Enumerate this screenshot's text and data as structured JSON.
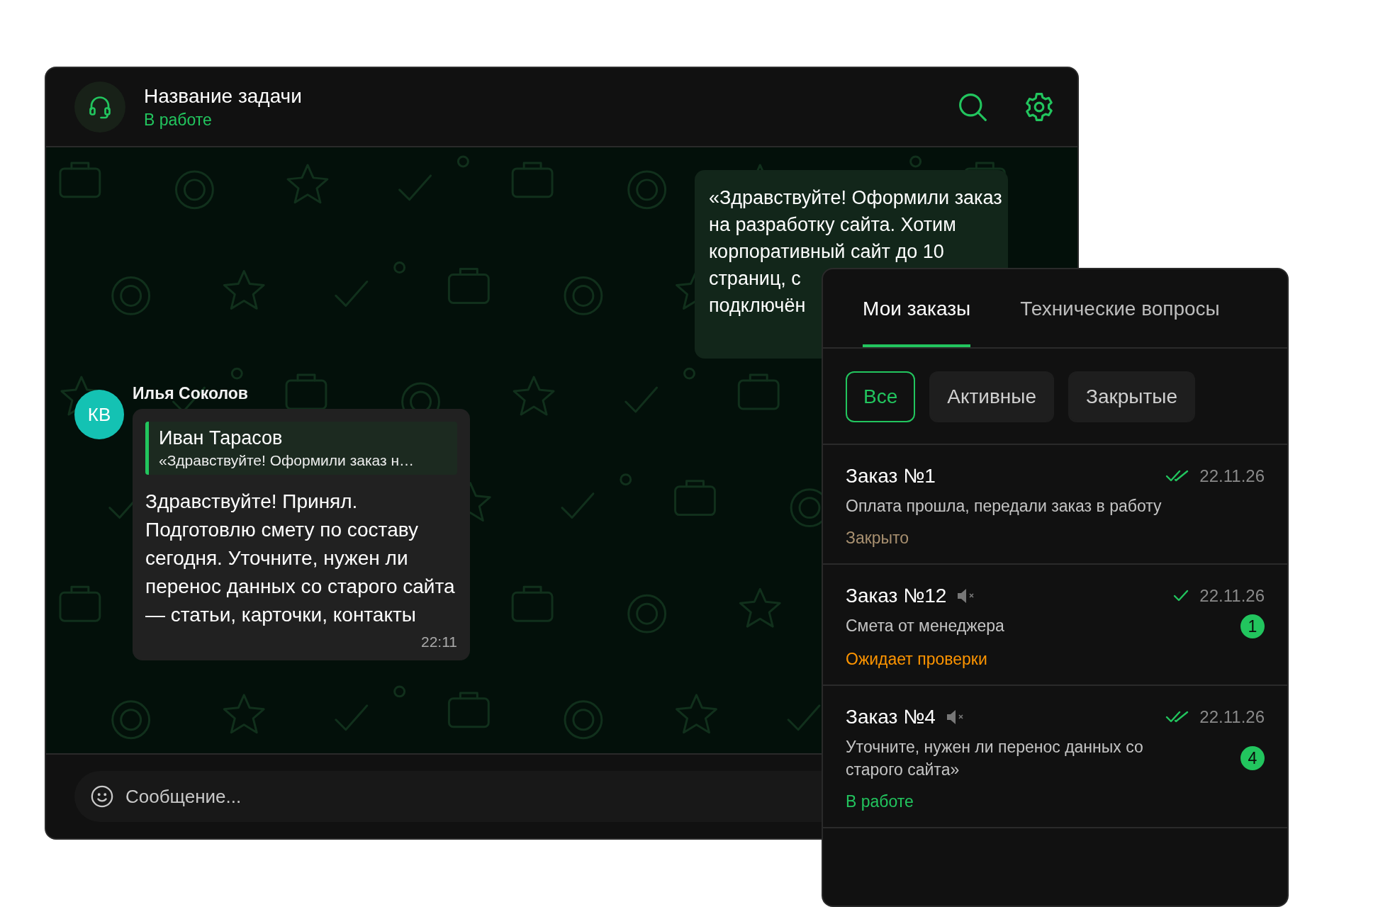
{
  "chat": {
    "title": "Название задачи",
    "status": "В работе",
    "outgoing_message": {
      "lines": [
        "«Здравствуйте! Оформили заказ",
        "на разработку сайта. Хотим",
        "корпоративный сайт до 10",
        "страниц, с",
        "подключён"
      ]
    },
    "incoming_message": {
      "avatar_initials": "КВ",
      "author": "Илья Соколов",
      "reply_to": {
        "author": "Иван Тарасов",
        "text": "«Здравствуйте! Оформили заказ н…"
      },
      "text": "Здравствуйте! Принял. Подготовлю смету по составу сегодня. Уточните, нужен ли перенос данных со старого сайта — статьи, карточки, контакты",
      "time": "22:11"
    },
    "composer": {
      "placeholder": "Сообщение..."
    }
  },
  "orders_panel": {
    "tabs": [
      {
        "label": "Мои заказы",
        "selected": true
      },
      {
        "label": "Технические вопросы",
        "selected": false
      }
    ],
    "filters": [
      {
        "label": "Все",
        "selected": true
      },
      {
        "label": "Активные",
        "selected": false
      },
      {
        "label": "Закрытые",
        "selected": false
      }
    ],
    "orders": [
      {
        "title": "Заказ №1",
        "muted": false,
        "read": true,
        "date": "22.11.26",
        "preview": "Оплата прошла, передали заказ в работу",
        "status": "Закрыто",
        "color": "#a89070"
      },
      {
        "title": "Заказ №12",
        "muted": true,
        "read": false,
        "date": "22.11.26",
        "preview": "Смета от менеджера",
        "unread": "1",
        "status": "Ожидает проверки",
        "color": "#ff9500"
      },
      {
        "title": "Заказ №4",
        "muted": true,
        "read": true,
        "date": "22.11.26",
        "preview": "Уточните, нужен ли перенос данных со старого сайта»",
        "unread": "4",
        "status": "В работе",
        "color": "#22c55e"
      }
    ]
  }
}
